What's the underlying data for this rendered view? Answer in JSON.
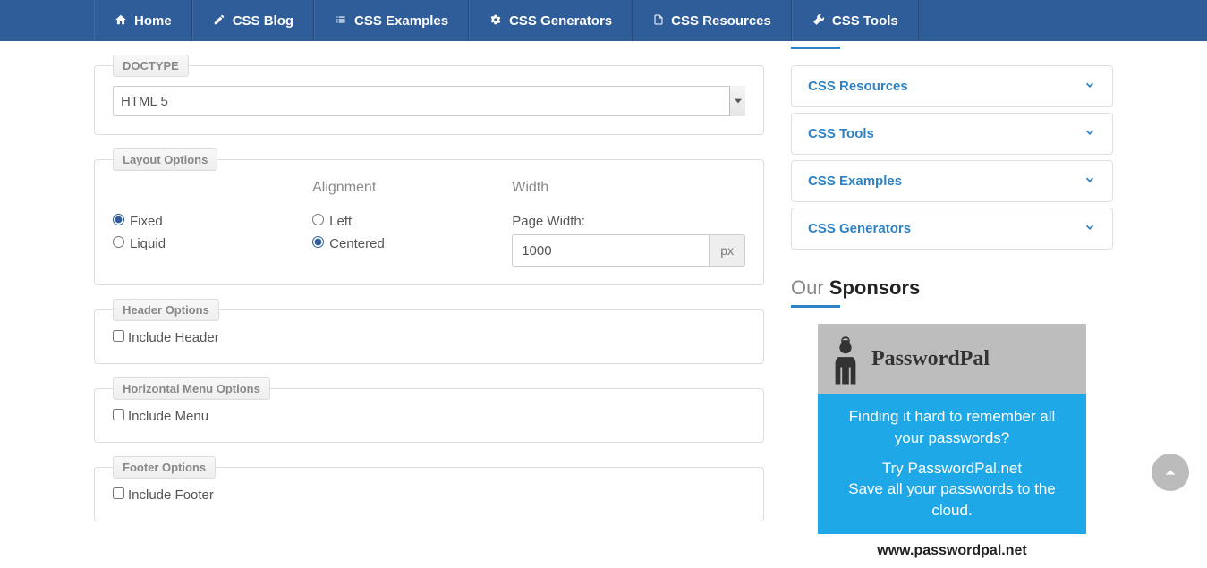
{
  "nav": {
    "home": "Home",
    "blog": "CSS Blog",
    "examples": "CSS Examples",
    "generators": "CSS Generators",
    "resources": "CSS Resources",
    "tools": "CSS Tools"
  },
  "form": {
    "doctype": {
      "legend": "DOCTYPE",
      "selected": "HTML 5"
    },
    "layout": {
      "legend": "Layout Options",
      "alignment_heading": "Alignment",
      "width_heading": "Width",
      "fixed": "Fixed",
      "liquid": "Liquid",
      "left": "Left",
      "centered": "Centered",
      "page_width_label": "Page Width:",
      "page_width_value": "1000",
      "page_width_unit": "px"
    },
    "header": {
      "legend": "Header Options",
      "include": "Include Header"
    },
    "menu": {
      "legend": "Horizontal Menu Options",
      "include": "Include Menu"
    },
    "footer": {
      "legend": "Footer Options",
      "include": "Include Footer"
    }
  },
  "sidebar": {
    "accordion": {
      "resources": "CSS Resources",
      "tools": "CSS Tools",
      "examples": "CSS Examples",
      "generators": "CSS Generators"
    },
    "sponsors_title_light": "Our ",
    "sponsors_title_bold": "Sponsors",
    "ad": {
      "brand": "PasswordPal",
      "line1": "Finding it hard to remember all your passwords?",
      "line2": "Try PasswordPal.net",
      "line3": "Save all your passwords to the cloud.",
      "url": "www.passwordpal.net"
    }
  }
}
